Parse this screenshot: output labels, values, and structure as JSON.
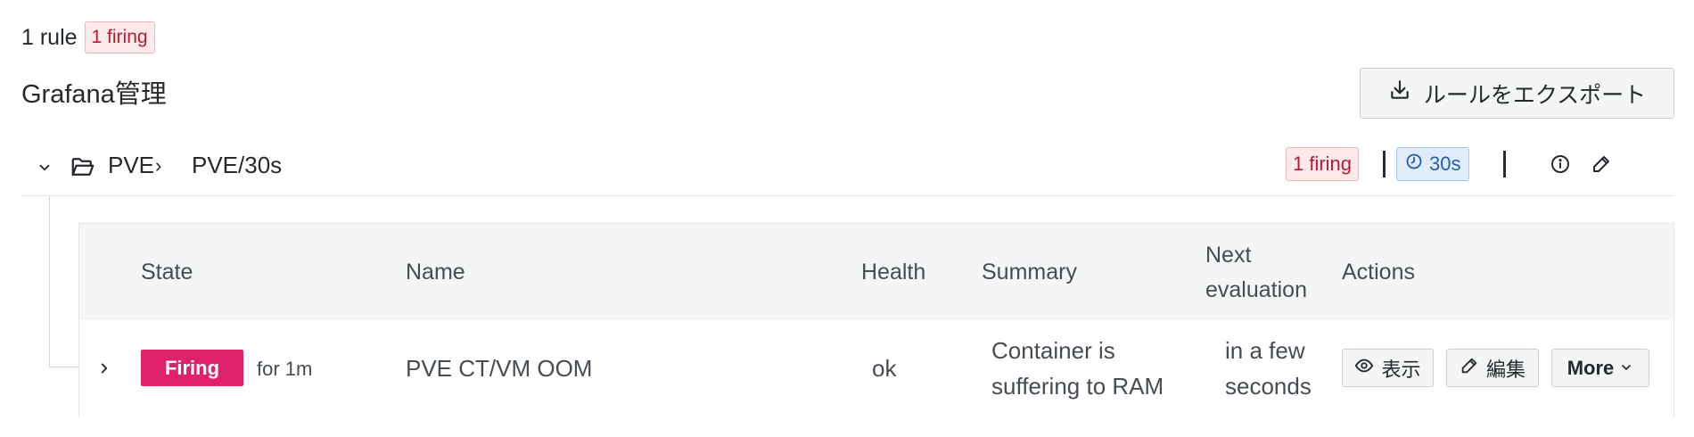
{
  "summary": {
    "rule_count": "1 rule",
    "firing_badge": "1 firing"
  },
  "section": {
    "title": "Grafana管理",
    "export_button_label": "ルールをエクスポート"
  },
  "group": {
    "folder": "PVE",
    "name": "PVE/30s",
    "firing_badge": "1 firing",
    "interval": "30s"
  },
  "table": {
    "headers": {
      "state": "State",
      "name": "Name",
      "health": "Health",
      "summary": "Summary",
      "next_eval_line1": "Next",
      "next_eval_line2": "evaluation",
      "actions": "Actions"
    },
    "rows": [
      {
        "state": "Firing",
        "duration": "for 1m",
        "name": "PVE CT/VM OOM",
        "health": "ok",
        "summary_line1": "Container is",
        "summary_line2": "suffering to RAM",
        "next_eval_line1": "in a few",
        "next_eval_line2": "seconds",
        "actions": {
          "view": "表示",
          "edit": "編集",
          "more": "More"
        }
      }
    ]
  },
  "colors": {
    "firing": "#e0226e",
    "firing_badge_bg": "#fde8ea",
    "firing_badge_text": "#b41d32",
    "interval_badge_bg": "#e1ecfa",
    "interval_badge_text": "#1f5fb1",
    "header_bg": "#f4f5f5"
  },
  "icons": {
    "export": "download-icon",
    "group_toggle": "chevron-down-icon",
    "folder": "folder-open-icon",
    "separator": "chevron-right-icon",
    "interval": "clock-icon",
    "info": "info-icon",
    "edit": "pencil-icon",
    "row_expand": "chevron-right-icon",
    "view": "eye-icon",
    "more": "chevron-down-icon"
  }
}
